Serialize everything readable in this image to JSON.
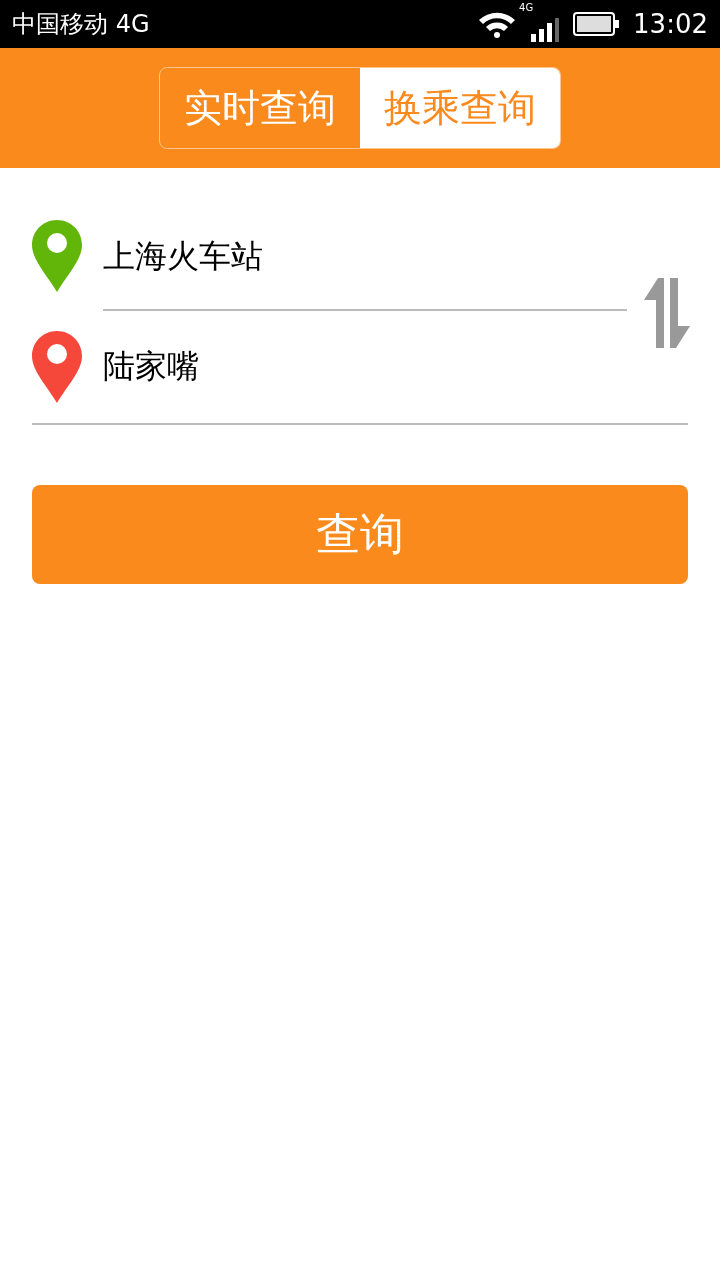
{
  "status_bar": {
    "carrier": "中国移动 4G",
    "network_type": "4G",
    "time": "13:02"
  },
  "tabs": [
    {
      "label": "实时查询",
      "selected": false
    },
    {
      "label": "换乘查询",
      "selected": true
    }
  ],
  "route": {
    "stops": [
      {
        "value": "上海火车站",
        "color": "#62b60a"
      },
      {
        "value": "陆家嘴",
        "color": "#f5473a"
      }
    ]
  },
  "search_button": "查询"
}
